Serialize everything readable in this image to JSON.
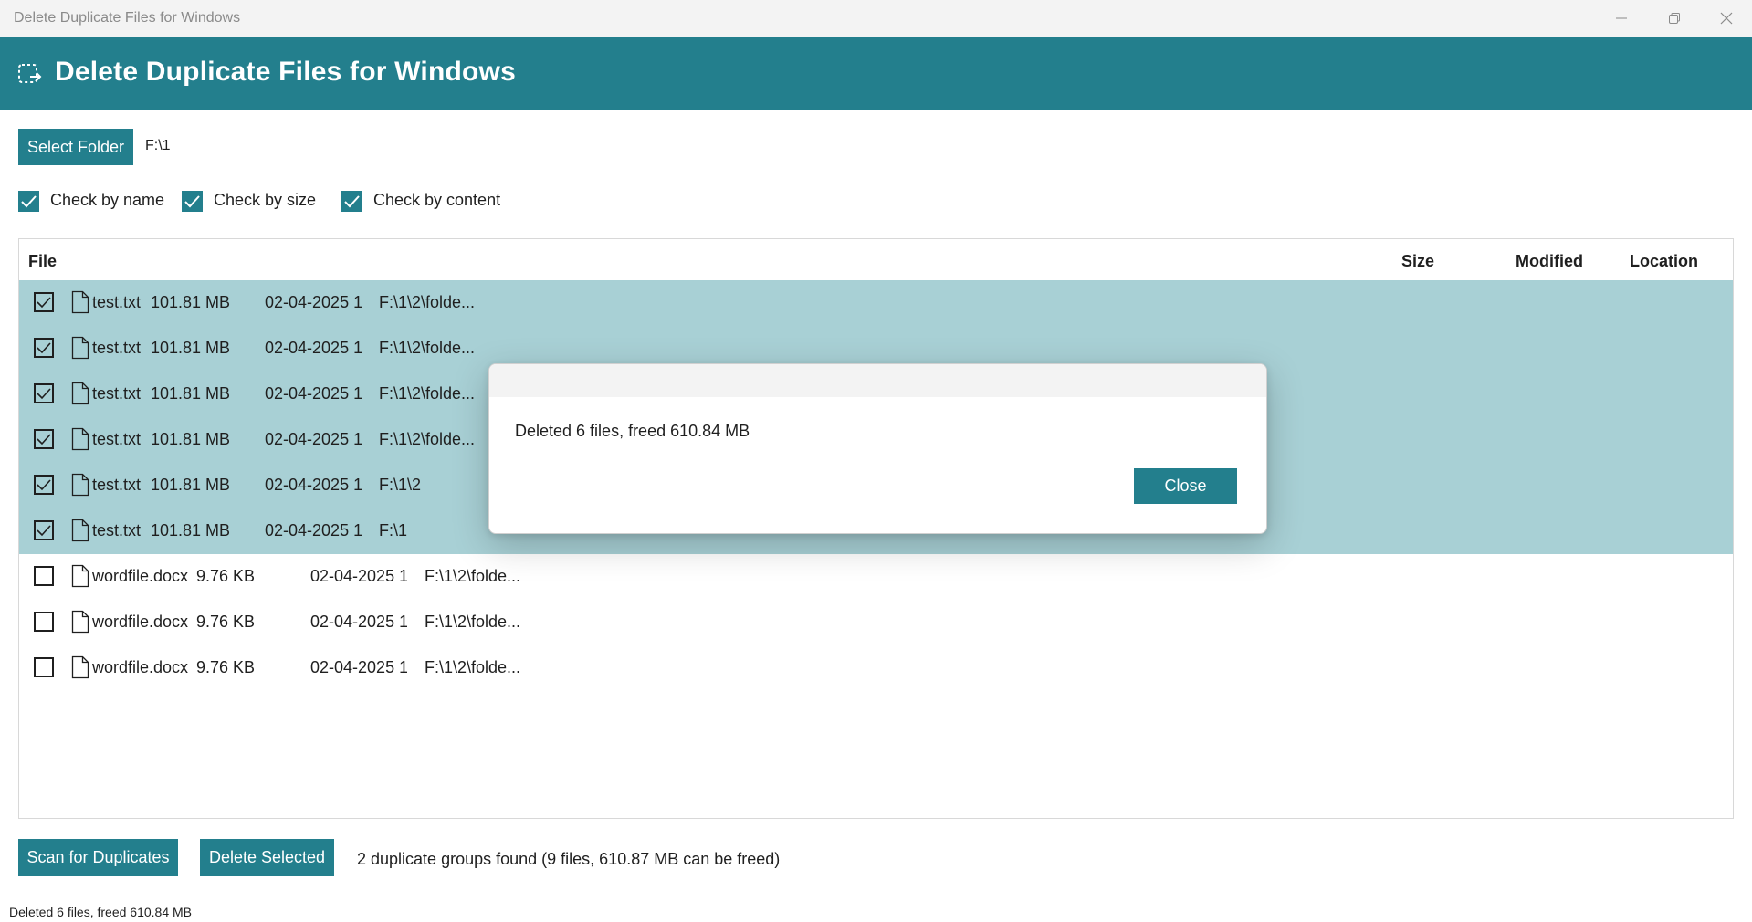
{
  "window": {
    "title": "Delete Duplicate Files for Windows",
    "controls": [
      "minimize-icon",
      "restore-icon",
      "close-icon"
    ]
  },
  "header": {
    "icon": "dashed-select-arrow-icon",
    "title": "Delete Duplicate Files for Windows"
  },
  "folder": {
    "select_label": "Select Folder",
    "path": "F:\\1"
  },
  "options": [
    {
      "label": "Check by name",
      "checked": true
    },
    {
      "label": "Check by size",
      "checked": true
    },
    {
      "label": "Check by content",
      "checked": true
    }
  ],
  "table": {
    "columns": [
      "File",
      "Size",
      "Modified",
      "Location"
    ],
    "rows": [
      {
        "checked": true,
        "name": "test.txt",
        "size": "101.81 MB",
        "modified": "02-04-2025 1(",
        "location": "F:\\1\\2\\folde..."
      },
      {
        "checked": true,
        "name": "test.txt",
        "size": "101.81 MB",
        "modified": "02-04-2025 1(",
        "location": "F:\\1\\2\\folde..."
      },
      {
        "checked": true,
        "name": "test.txt",
        "size": "101.81 MB",
        "modified": "02-04-2025 1(",
        "location": "F:\\1\\2\\folde..."
      },
      {
        "checked": true,
        "name": "test.txt",
        "size": "101.81 MB",
        "modified": "02-04-2025 1(",
        "location": "F:\\1\\2\\folde..."
      },
      {
        "checked": true,
        "name": "test.txt",
        "size": "101.81 MB",
        "modified": "02-04-2025 1(",
        "location": "F:\\1\\2"
      },
      {
        "checked": true,
        "name": "test.txt",
        "size": "101.81 MB",
        "modified": "02-04-2025 1(",
        "location": "F:\\1"
      },
      {
        "checked": false,
        "name": "wordfile.docx",
        "size": "9.76 KB",
        "modified": "02-04-2025 1(",
        "location": "F:\\1\\2\\folde..."
      },
      {
        "checked": false,
        "name": "wordfile.docx",
        "size": "9.76 KB",
        "modified": "02-04-2025 1(",
        "location": "F:\\1\\2\\folde..."
      },
      {
        "checked": false,
        "name": "wordfile.docx",
        "size": "9.76 KB",
        "modified": "02-04-2025 1(",
        "location": "F:\\1\\2\\folde..."
      }
    ]
  },
  "dialog": {
    "message": "Deleted 6 files, freed 610.84 MB",
    "close_label": "Close"
  },
  "actions": {
    "scan_label": "Scan for Duplicates",
    "delete_label": "Delete Selected",
    "summary": "2 duplicate groups found (9 files, 610.87 MB can be freed)"
  },
  "status": "Deleted 6 files, freed 610.84 MB",
  "colors": {
    "accent": "#237f8d",
    "selected_row": "#a8d0d5",
    "titlebar": "#f3f3f3"
  }
}
